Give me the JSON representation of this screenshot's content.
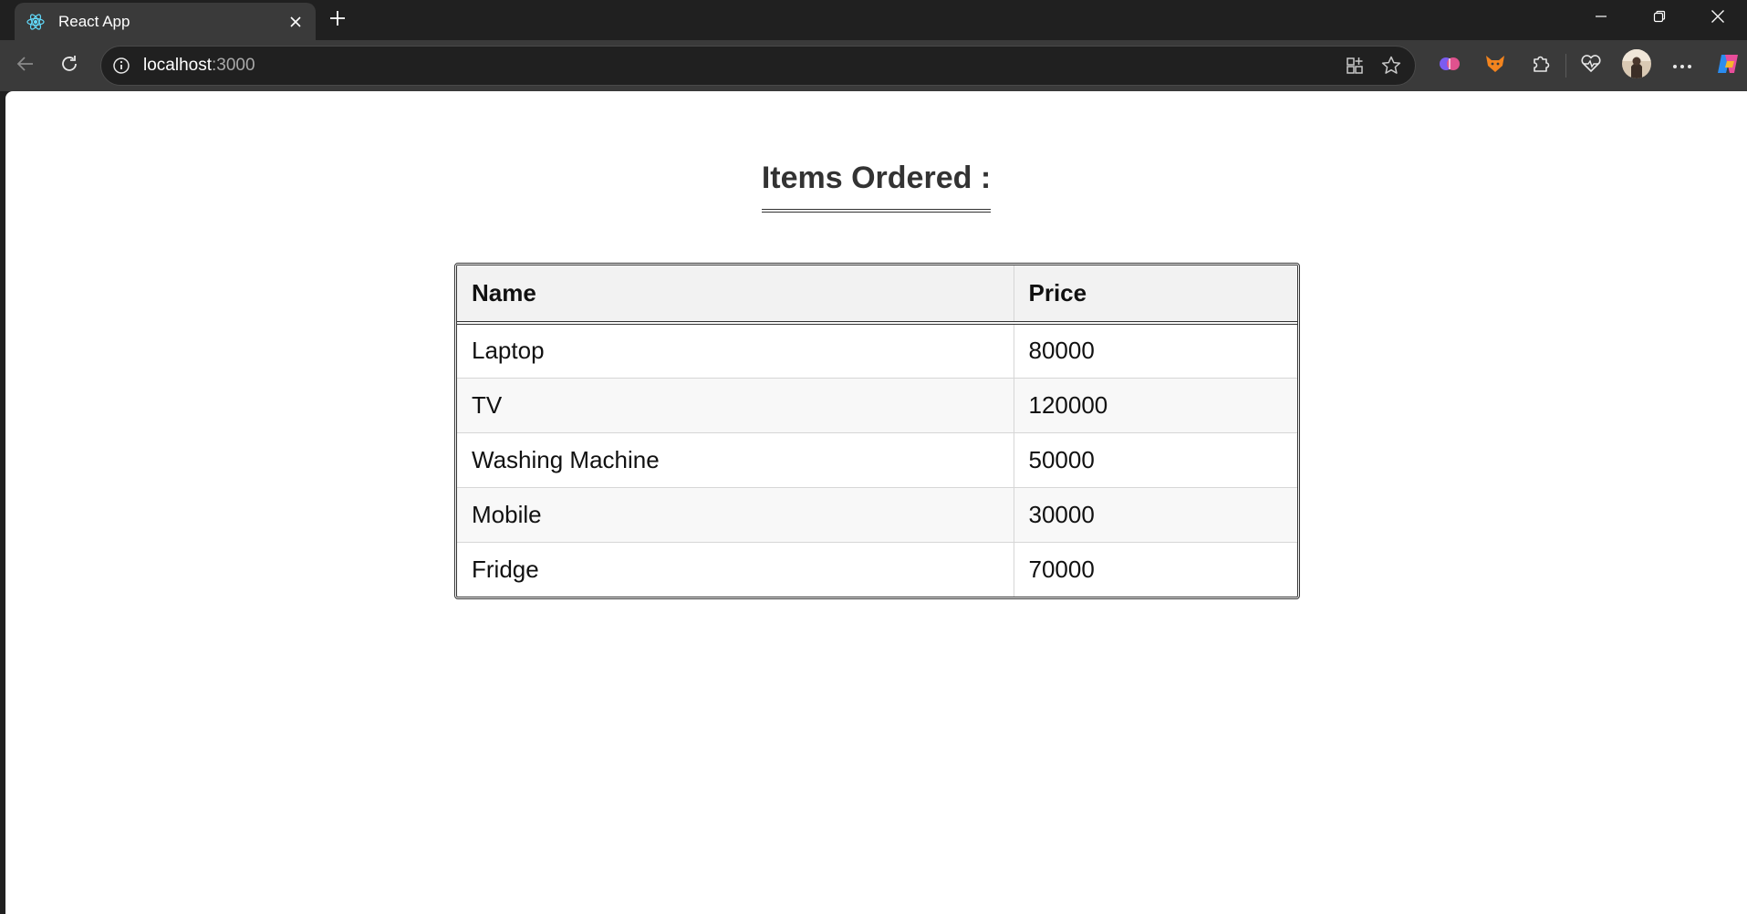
{
  "browser": {
    "tab": {
      "title": "React App",
      "favicon": "react-logo-icon"
    },
    "address": {
      "host": "localhost",
      "port": ":3000"
    },
    "colors": {
      "chrome": "#202020",
      "toolbar": "#3a3a3a",
      "page": "#ffffff"
    }
  },
  "page": {
    "heading": "Items Ordered :",
    "table": {
      "headers": [
        "Name",
        "Price"
      ],
      "rows": [
        {
          "name": "Laptop",
          "price": "80000"
        },
        {
          "name": "TV",
          "price": "120000"
        },
        {
          "name": "Washing Machine",
          "price": "50000"
        },
        {
          "name": "Mobile",
          "price": "30000"
        },
        {
          "name": "Fridge",
          "price": "70000"
        }
      ]
    }
  }
}
